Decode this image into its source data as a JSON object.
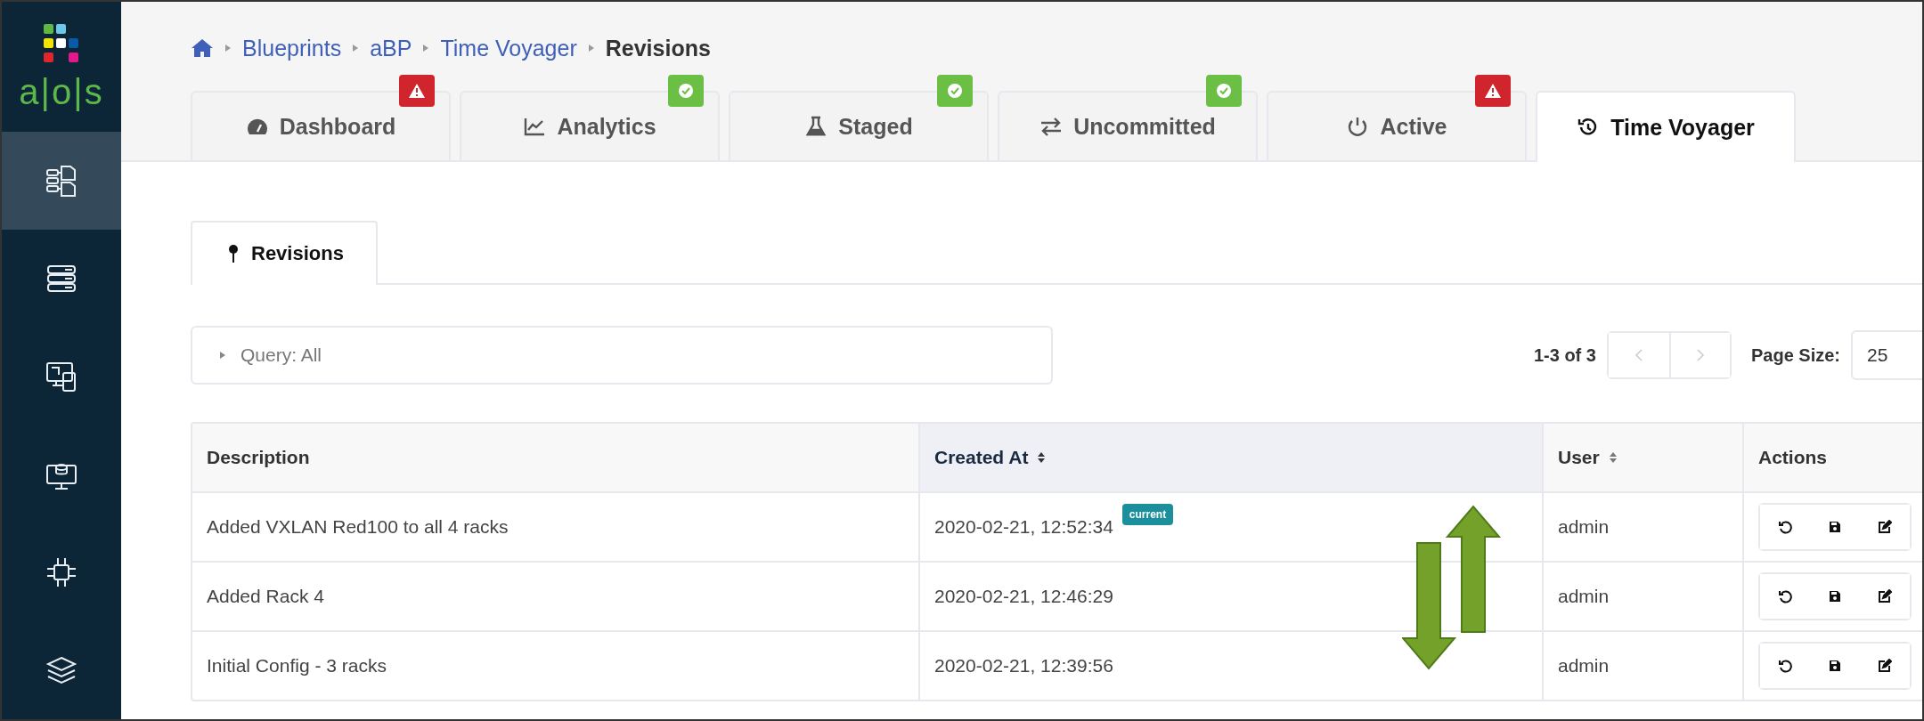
{
  "sidebar": {
    "logo_text": "a|o|s",
    "items": [
      {
        "kind": "blueprints",
        "selected": true
      },
      {
        "kind": "devices",
        "selected": false
      },
      {
        "kind": "design",
        "selected": false
      },
      {
        "kind": "resources",
        "selected": false
      },
      {
        "kind": "external",
        "selected": false
      },
      {
        "kind": "layers",
        "selected": false
      }
    ]
  },
  "breadcrumb": [
    {
      "label": "Blueprints"
    },
    {
      "label": "aBP"
    },
    {
      "label": "Time Voyager"
    },
    {
      "label": "Revisions"
    }
  ],
  "tabs": [
    {
      "label": "Dashboard",
      "kind": "dashboard",
      "badge": {
        "kind": "warning"
      },
      "selected": false
    },
    {
      "label": "Analytics",
      "kind": "analytics",
      "badge": {
        "kind": "ok"
      },
      "selected": false
    },
    {
      "label": "Staged",
      "kind": "staged",
      "badge": {
        "kind": "ok"
      },
      "selected": false
    },
    {
      "label": "Uncommitted",
      "kind": "uncommitted",
      "badge": {
        "kind": "ok"
      },
      "selected": false
    },
    {
      "label": "Active",
      "kind": "active",
      "badge": {
        "kind": "warning"
      },
      "selected": false
    },
    {
      "label": "Time Voyager",
      "kind": "history",
      "selected": true
    }
  ],
  "subtabs": [
    {
      "label": "Revisions",
      "selected": true
    }
  ],
  "query": {
    "label": "Query: All"
  },
  "pagination": {
    "range": "1-3 of 3",
    "page_size_label": "Page Size:",
    "page_size": "25"
  },
  "table": {
    "columns": [
      {
        "label": "Description",
        "sortable": false,
        "sorted": false
      },
      {
        "label": "Created At",
        "sortable": true,
        "sorted": true
      },
      {
        "label": "User",
        "sortable": true,
        "sorted": false
      },
      {
        "label": "Actions",
        "sortable": false,
        "sorted": false
      }
    ],
    "rows": [
      {
        "description": "Added VXLAN Red100 to all 4 racks",
        "created_at": "2020-02-21, 12:52:34",
        "badge": "current",
        "user": "admin"
      },
      {
        "description": "Added Rack 4",
        "created_at": "2020-02-21, 12:46:29",
        "user": "admin"
      },
      {
        "description": "Initial Config - 3 racks",
        "created_at": "2020-02-21, 12:39:56",
        "user": "admin"
      }
    ]
  }
}
